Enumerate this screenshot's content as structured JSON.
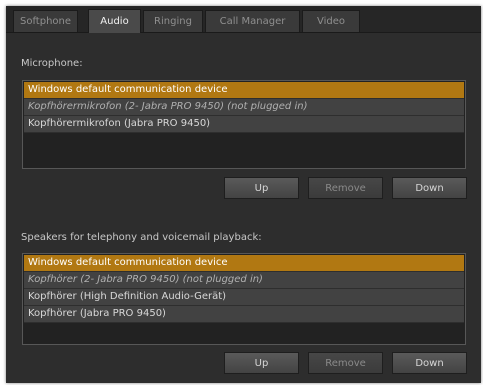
{
  "tabs": [
    {
      "label": "Softphone",
      "active": false
    },
    {
      "label": "Audio",
      "active": true
    },
    {
      "label": "Ringing",
      "active": false
    },
    {
      "label": "Call Manager",
      "active": false
    },
    {
      "label": "Video",
      "active": false
    }
  ],
  "microphone": {
    "label": "Microphone:",
    "items": [
      {
        "label": "Windows default communication device",
        "selected": true,
        "italic": false
      },
      {
        "label": "Kopfhörermikrofon (2- Jabra PRO 9450) (not plugged in)",
        "selected": false,
        "italic": true
      },
      {
        "label": "Kopfhörermikrofon (Jabra PRO 9450)",
        "selected": false,
        "italic": false
      }
    ],
    "buttons": {
      "up": "Up",
      "remove": "Remove",
      "down": "Down"
    }
  },
  "speakers": {
    "label": "Speakers for telephony and voicemail playback:",
    "items": [
      {
        "label": "Windows default communication device",
        "selected": true,
        "italic": false
      },
      {
        "label": "Kopfhörer (2- Jabra PRO 9450) (not plugged in)",
        "selected": false,
        "italic": true
      },
      {
        "label": "Kopfhörer (High Definition Audio-Gerät)",
        "selected": false,
        "italic": false
      },
      {
        "label": "Kopfhörer (Jabra PRO 9450)",
        "selected": false,
        "italic": false
      }
    ],
    "buttons": {
      "up": "Up",
      "remove": "Remove",
      "down": "Down"
    }
  },
  "colors": {
    "selected": "#b17812",
    "panel": "#2d2d2d",
    "list_row": "#424242"
  }
}
